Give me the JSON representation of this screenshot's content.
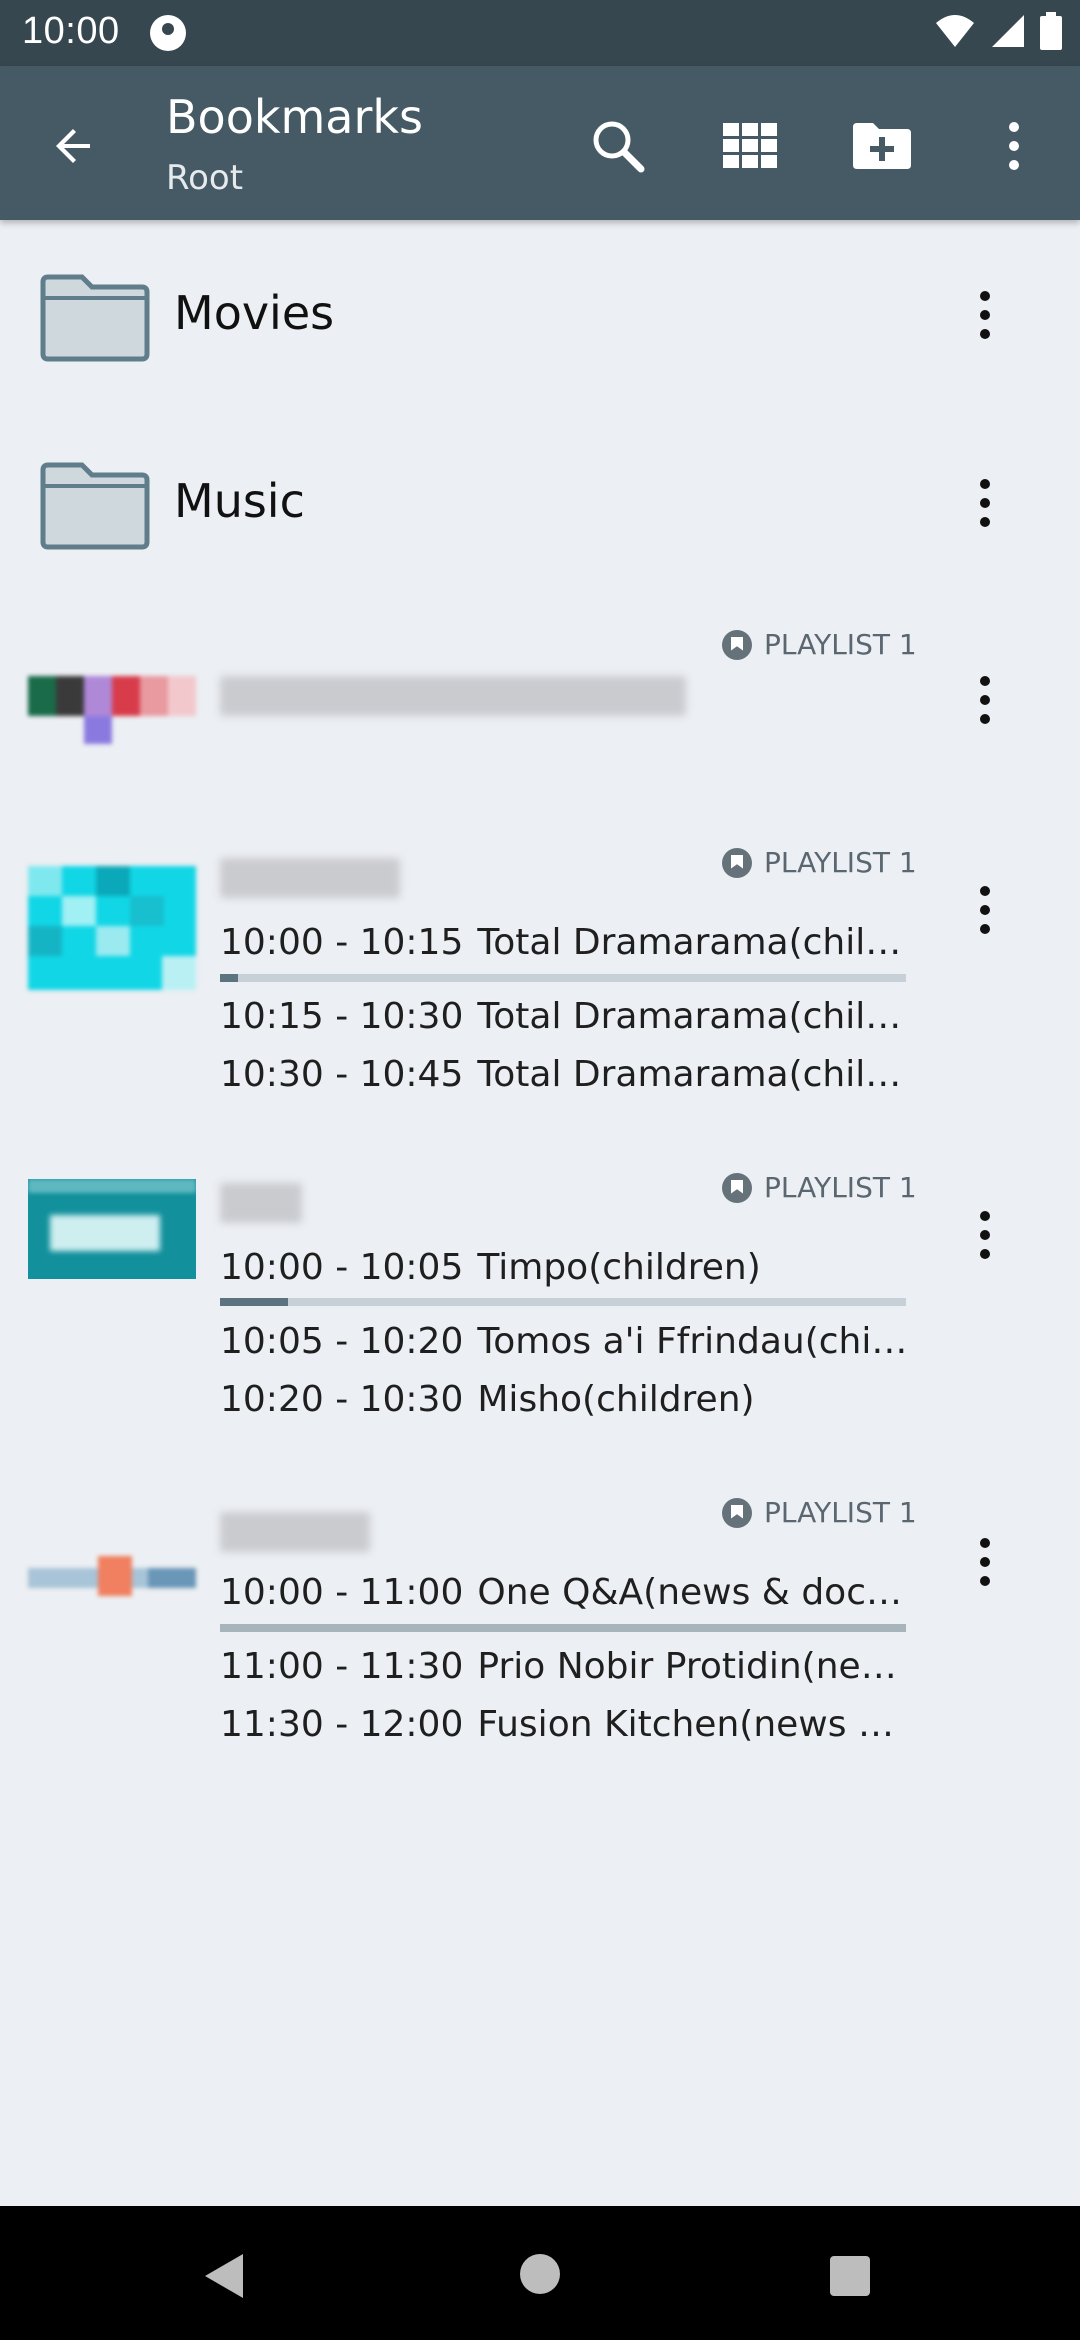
{
  "status_bar": {
    "time": "10:00"
  },
  "app_bar": {
    "title": "Bookmarks",
    "subtitle": "Root"
  },
  "folders": [
    {
      "label": "Movies"
    },
    {
      "label": "Music"
    }
  ],
  "channels": [
    {
      "badge": "PLAYLIST 1",
      "programs": []
    },
    {
      "badge": "PLAYLIST 1",
      "programs": [
        {
          "time": "10:00 - 10:15",
          "title": "Total Dramarama(children)"
        },
        {
          "time": "10:15 - 10:30",
          "title": "Total Dramarama(children)"
        },
        {
          "time": "10:30 - 10:45",
          "title": "Total Dramarama(children)"
        }
      ],
      "progress": 0.02
    },
    {
      "badge": "PLAYLIST 1",
      "programs": [
        {
          "time": "10:00 - 10:05",
          "title": "Timpo(children)"
        },
        {
          "time": "10:05 - 10:20",
          "title": "Tomos a'i Ffrindau(children)"
        },
        {
          "time": "10:20 - 10:30",
          "title": "Misho(children)"
        }
      ],
      "progress": 0.07
    },
    {
      "badge": "PLAYLIST 1",
      "programs": [
        {
          "time": "10:00 - 11:00",
          "title": "One Q&A(news & document…"
        },
        {
          "time": "11:00 - 11:30",
          "title": "Prio Nobir Protidin(news & …"
        },
        {
          "time": "11:30 - 12:00",
          "title": "Fusion Kitchen(news & doc…"
        }
      ],
      "progress": 0.0
    }
  ],
  "colors": {
    "app_bar": "#455a64",
    "status_bar": "#37474f",
    "background": "#eceff3"
  }
}
